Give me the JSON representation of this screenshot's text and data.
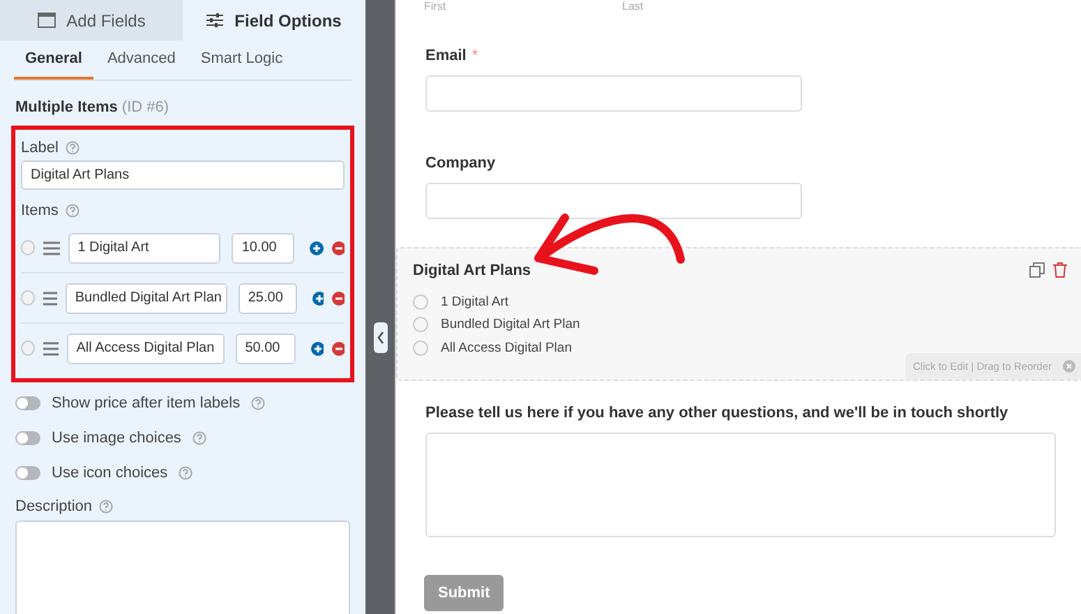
{
  "sidebar": {
    "tabs": [
      {
        "label": "Add Fields",
        "selected": false
      },
      {
        "label": "Field Options",
        "selected": true
      }
    ],
    "subtabs": [
      {
        "label": "General",
        "selected": true
      },
      {
        "label": "Advanced",
        "selected": false
      },
      {
        "label": "Smart Logic",
        "selected": false
      }
    ],
    "field_title": "Multiple Items",
    "field_id": "(ID #6)",
    "label_caption": "Label",
    "label_value": "Digital Art Plans",
    "items_caption": "Items",
    "items": [
      {
        "name": "1 Digital Art",
        "price": "10.00",
        "selected": false
      },
      {
        "name": "Bundled Digital Art Plan",
        "price": "25.00",
        "selected": false
      },
      {
        "name": "All Access Digital Plan",
        "price": "50.00",
        "selected": false
      }
    ],
    "toggles": [
      {
        "label": "Show price after item labels",
        "on": false
      },
      {
        "label": "Use image choices",
        "on": false
      },
      {
        "label": "Use icon choices",
        "on": false
      }
    ],
    "description_caption": "Description"
  },
  "form": {
    "name_sublabels": [
      "First",
      "Last"
    ],
    "fields": [
      {
        "kind": "text",
        "label": "Email",
        "required_mark": "*",
        "selected": false
      },
      {
        "kind": "text",
        "label": "Company",
        "selected": false
      },
      {
        "kind": "choices",
        "label": "Digital Art Plans",
        "selected": true,
        "options": [
          "1 Digital Art",
          "Bundled Digital Art Plan",
          "All Access Digital Plan"
        ],
        "hint": "Click to Edit | Drag to Reorder"
      },
      {
        "kind": "textarea",
        "label": "Please tell us here if you have any other questions, and we'll be in touch shortly",
        "selected": false
      }
    ],
    "submit": "Submit"
  }
}
